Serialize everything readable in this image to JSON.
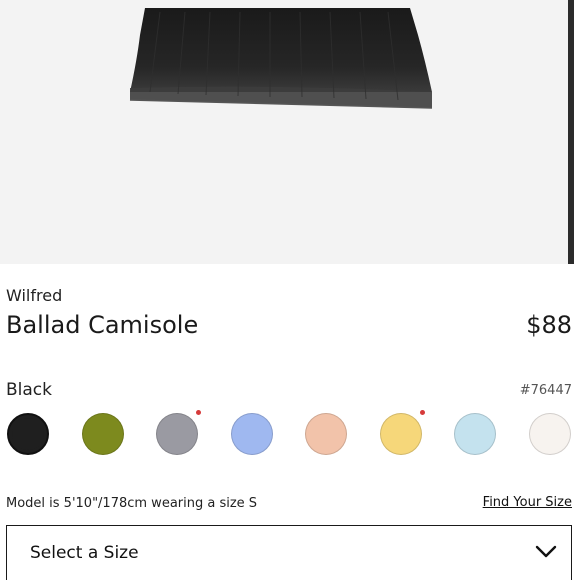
{
  "product": {
    "brand": "Wilfred",
    "name": "Ballad Camisole",
    "price": "$88",
    "selected_color": "Black",
    "sku": "#76447"
  },
  "swatches": [
    {
      "name": "black",
      "color": "#1f1f1f",
      "selected": true,
      "marked": false
    },
    {
      "name": "olive",
      "color": "#7d8a1e",
      "selected": false,
      "marked": false
    },
    {
      "name": "grey",
      "color": "#9a9aa2",
      "selected": false,
      "marked": true
    },
    {
      "name": "periwinkle",
      "color": "#9fb8f0",
      "selected": false,
      "marked": false
    },
    {
      "name": "peach",
      "color": "#f2c3aa",
      "selected": false,
      "marked": false
    },
    {
      "name": "butter-yellow",
      "color": "#f6d77a",
      "selected": false,
      "marked": true
    },
    {
      "name": "light-blue",
      "color": "#c4e2ee",
      "selected": false,
      "marked": false
    },
    {
      "name": "ivory",
      "color": "#f7f3ef",
      "selected": false,
      "marked": false
    }
  ],
  "fit": {
    "model_note": "Model is 5'10\"/178cm wearing a size S",
    "find_size_link": "Find Your Size"
  },
  "size_select": {
    "label": "Select a Size",
    "icon": "chevron-down-icon"
  },
  "colors": {
    "marker_dot": "#d63a3a",
    "garment": "#1b1b1b"
  }
}
